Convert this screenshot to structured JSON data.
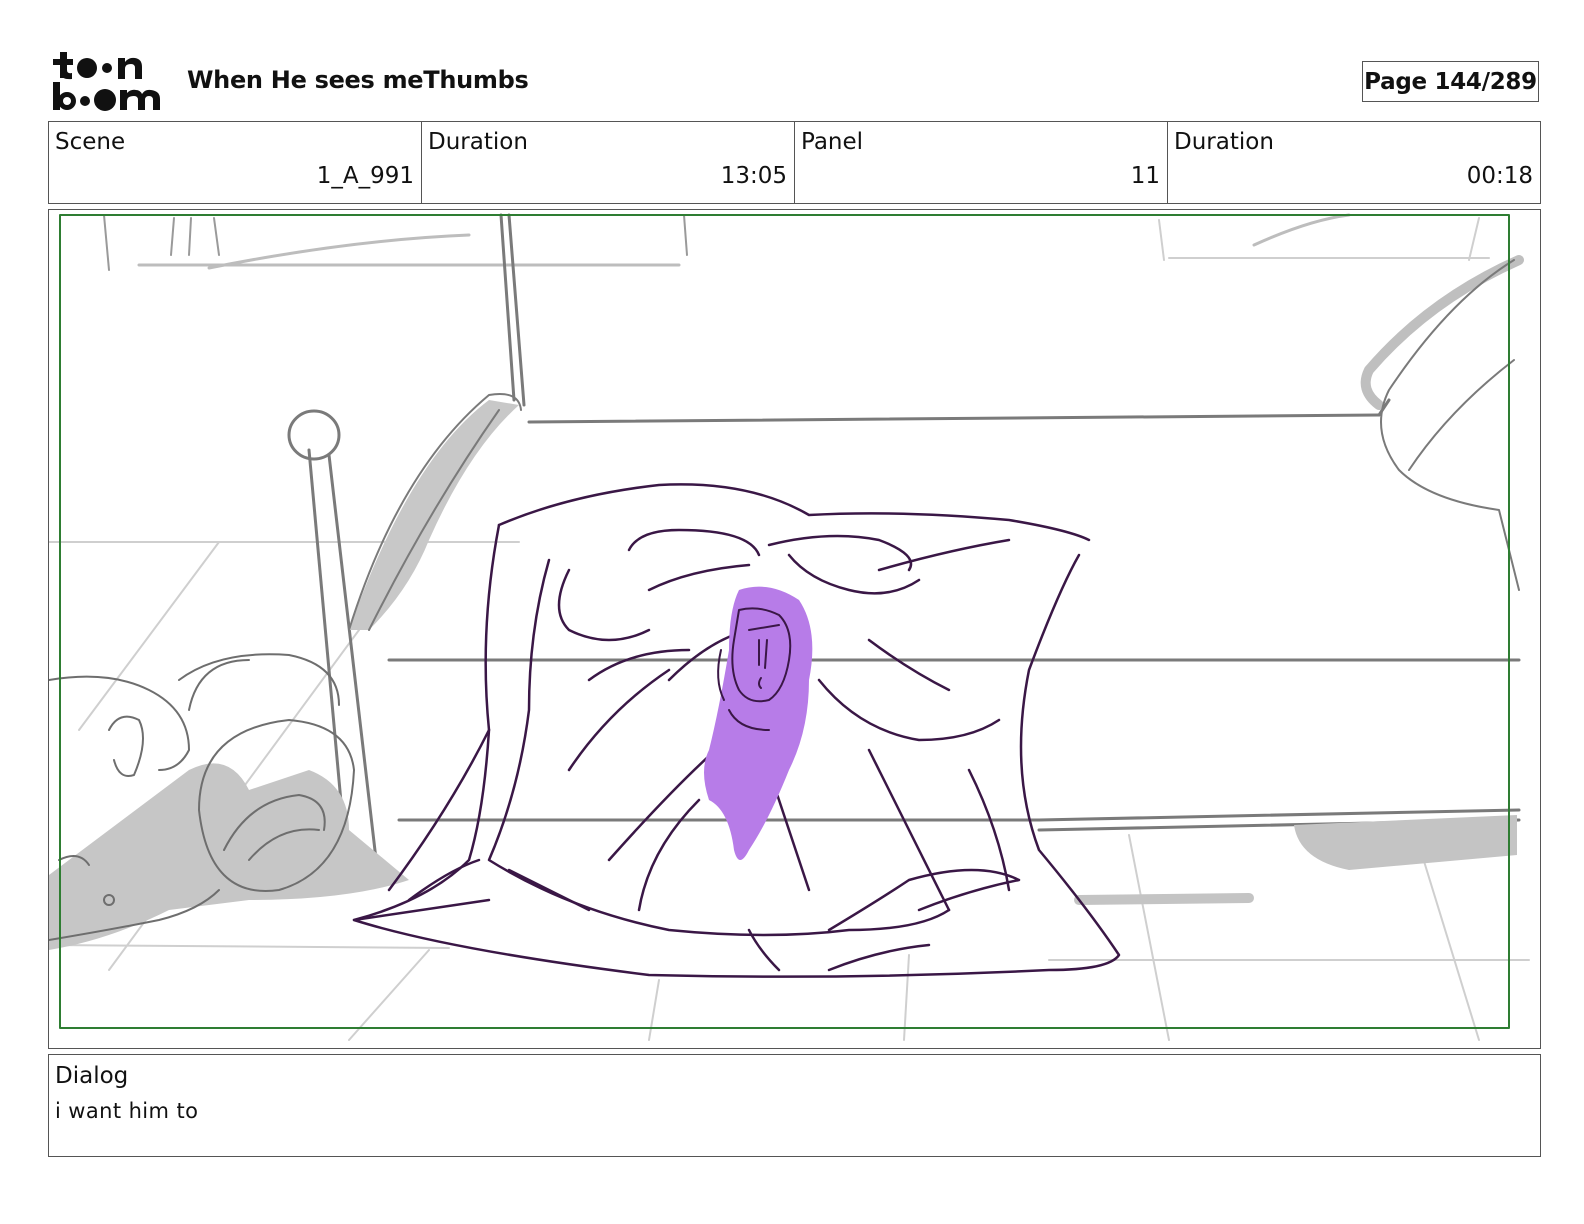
{
  "header": {
    "logo_text": "toonboom",
    "project_title": "When He sees meThumbs",
    "page_label": "Page 144/289"
  },
  "info": {
    "scene_label": "Scene",
    "scene_value": "1_A_991",
    "scene_duration_label": "Duration",
    "scene_duration_value": "13:05",
    "panel_label": "Panel",
    "panel_value": "11",
    "panel_duration_label": "Duration",
    "panel_duration_value": "00:18"
  },
  "dialog": {
    "label": "Dialog",
    "text": "i want him to"
  },
  "colors": {
    "frame_guide": "#2e7d32",
    "sketch_gray": "#8a8a8a",
    "shadow_gray": "#c4c4c4",
    "blanket_line": "#3a1746",
    "face_fill": "#b77ce8"
  }
}
